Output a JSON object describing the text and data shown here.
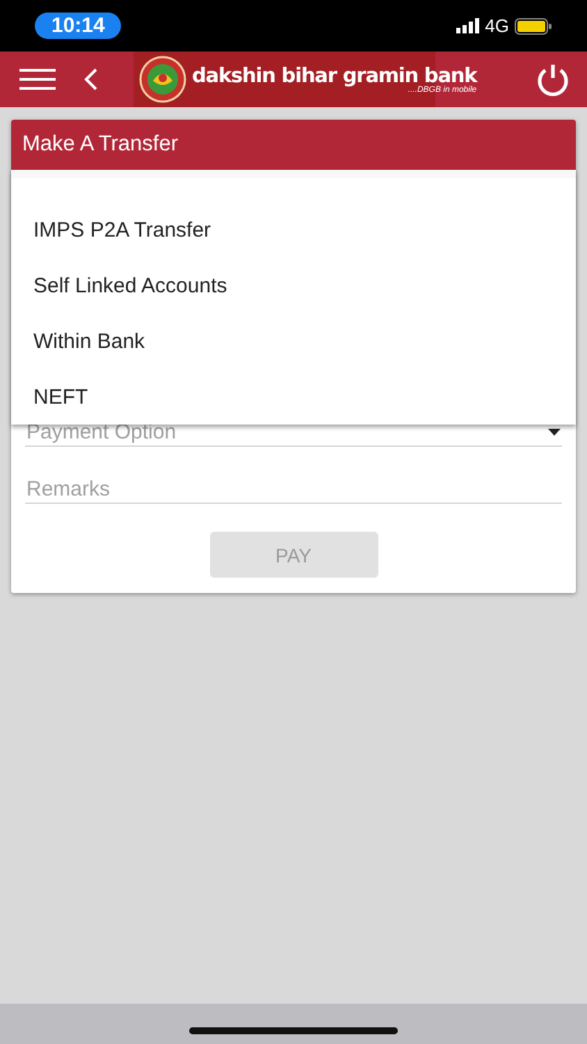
{
  "status_bar": {
    "time": "10:14",
    "network": "4G"
  },
  "app_bar": {
    "logo": {
      "name": "dakshin bihar gramin bank",
      "tagline": "....DBGB in mobile"
    }
  },
  "card": {
    "title": "Make A Transfer",
    "fields": [
      {
        "kind": "select",
        "placeholder": "Payment Option"
      },
      {
        "kind": "text",
        "placeholder": "Remarks"
      }
    ],
    "pay_button": {
      "label": "PAY",
      "disabled": true
    }
  },
  "dropdown": {
    "options": [
      {
        "label": "IMPS P2A Transfer"
      },
      {
        "label": "Self Linked Accounts"
      },
      {
        "label": "Within Bank"
      },
      {
        "label": "NEFT"
      }
    ]
  }
}
